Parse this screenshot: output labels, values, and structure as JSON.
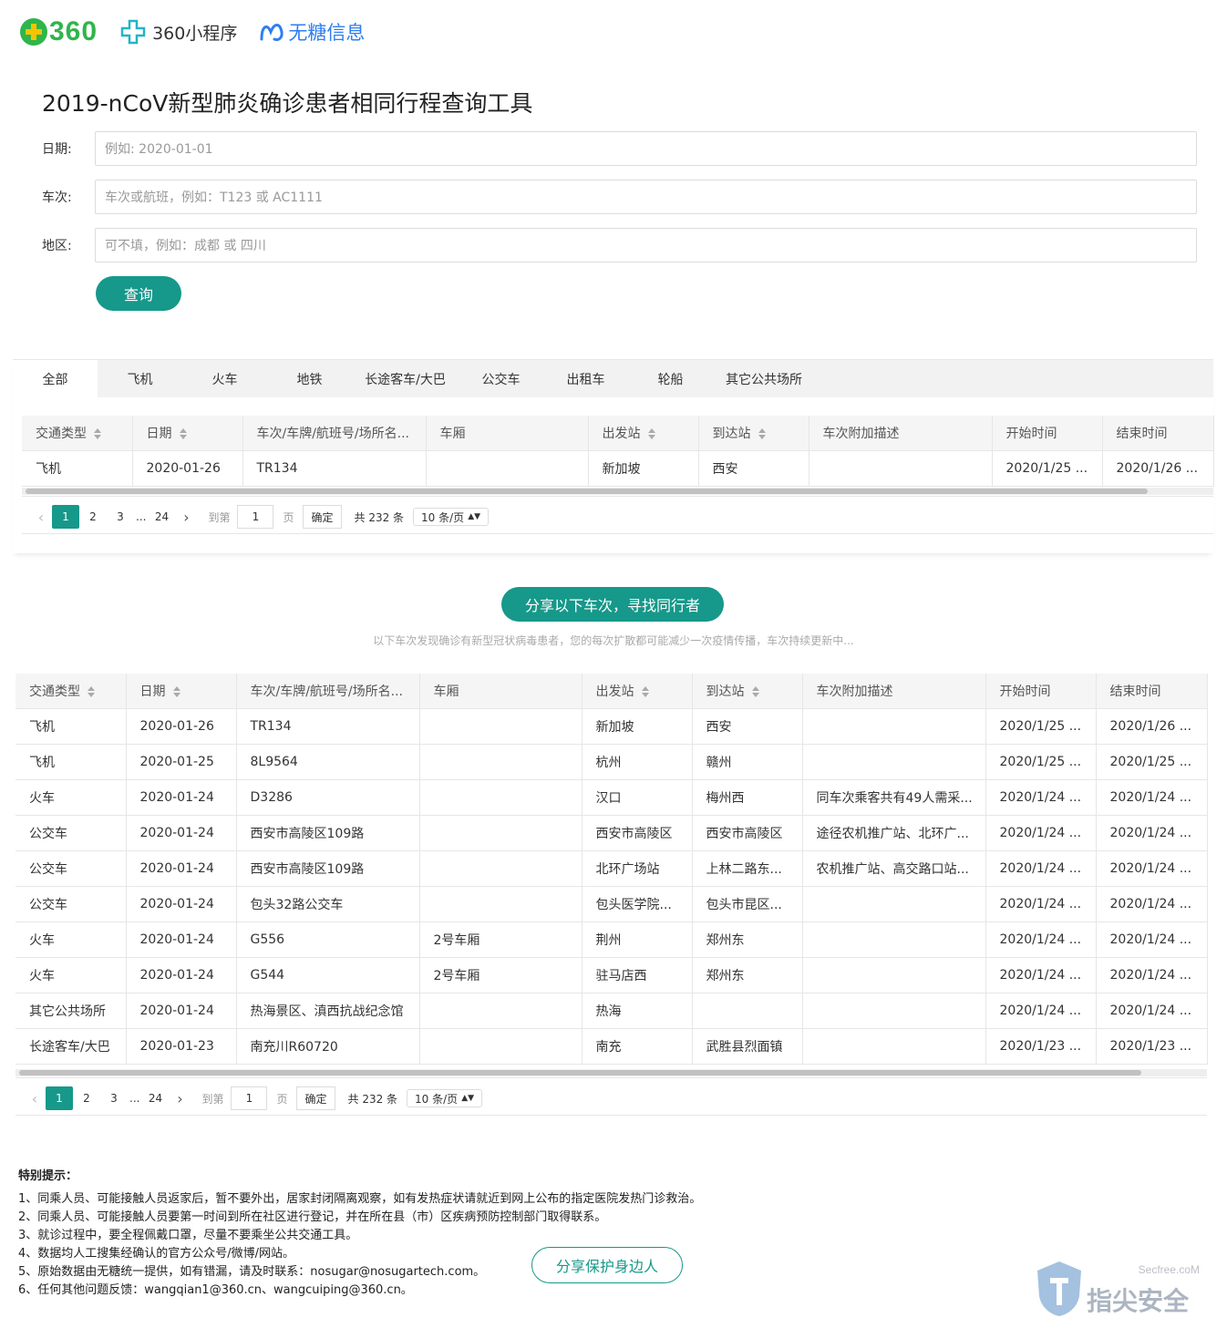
{
  "header": {
    "logo_360": "360",
    "logo_mini": "360小程序",
    "logo_wt": "无糖信息"
  },
  "page_title": "2019-nCoV新型肺炎确诊患者相同行程查询工具",
  "form": {
    "date_label": "日期:",
    "date_placeholder": "例如: 2020-01-01",
    "train_label": "车次:",
    "train_placeholder": "车次或航班，例如：T123 或 AC1111",
    "area_label": "地区:",
    "area_placeholder": "可不填，例如：成都 或 四川",
    "query_button": "查询"
  },
  "tabs": [
    "全部",
    "飞机",
    "火车",
    "地铁",
    "长途客车/大巴",
    "公交车",
    "出租车",
    "轮船",
    "其它公共场所"
  ],
  "active_tab": 0,
  "columns": [
    "交通类型",
    "日期",
    "车次/车牌/航班号/场所名...",
    "车厢",
    "出发站",
    "到达站",
    "车次附加描述",
    "开始时间",
    "结束时间"
  ],
  "search_results": [
    [
      "飞机",
      "2020-01-26",
      "TR134",
      "",
      "新加坡",
      "西安",
      "",
      "2020/1/25 ...",
      "2020/1/26 ..."
    ]
  ],
  "pagination": {
    "pages": [
      "1",
      "2",
      "3",
      "...",
      "24"
    ],
    "goto_label": "到第",
    "goto_value": "1",
    "page_unit": "页",
    "confirm": "确定",
    "total": "共 232 条",
    "page_size": "10 条/页"
  },
  "share": {
    "button": "分享以下车次，寻找同行者",
    "subtitle": "以下车次发现确诊有新型冠状病毒患者，您的每次扩散都可能减少一次疫情传播，车次持续更新中..."
  },
  "list_rows": [
    [
      "飞机",
      "2020-01-26",
      "TR134",
      "",
      "新加坡",
      "西安",
      "",
      "2020/1/25 ...",
      "2020/1/26 ..."
    ],
    [
      "飞机",
      "2020-01-25",
      "8L9564",
      "",
      "杭州",
      "赣州",
      "",
      "2020/1/25 ...",
      "2020/1/25 ..."
    ],
    [
      "火车",
      "2020-01-24",
      "D3286",
      "",
      "汉口",
      "梅州西",
      "同车次乘客共有49人需采...",
      "2020/1/24 ...",
      "2020/1/24 ..."
    ],
    [
      "公交车",
      "2020-01-24",
      "西安市高陵区109路",
      "",
      "西安市高陵区",
      "西安市高陵区",
      "途径农机推广站、北环广...",
      "2020/1/24 ...",
      "2020/1/24 ..."
    ],
    [
      "公交车",
      "2020-01-24",
      "西安市高陵区109路",
      "",
      "北环广场站",
      "上林二路东...",
      "农机推广站、高交路口站...",
      "2020/1/24 ...",
      "2020/1/24 ..."
    ],
    [
      "公交车",
      "2020-01-24",
      "包头32路公交车",
      "",
      "包头医学院...",
      "包头市昆区...",
      "",
      "2020/1/24 ...",
      "2020/1/24 ..."
    ],
    [
      "火车",
      "2020-01-24",
      "G556",
      "2号车厢",
      "荆州",
      "郑州东",
      "",
      "2020/1/24 ...",
      "2020/1/24 ..."
    ],
    [
      "火车",
      "2020-01-24",
      "G544",
      "2号车厢",
      "驻马店西",
      "郑州东",
      "",
      "2020/1/24 ...",
      "2020/1/24 ..."
    ],
    [
      "其它公共场所",
      "2020-01-24",
      "热海景区、滇西抗战纪念馆",
      "",
      "热海",
      "",
      "",
      "2020/1/24 ...",
      "2020/1/24 ..."
    ],
    [
      "长途客车/大巴",
      "2020-01-23",
      "南充川R60720",
      "",
      "南充",
      "武胜县烈面镇",
      "",
      "2020/1/23 ...",
      "2020/1/23 ..."
    ]
  ],
  "tips": {
    "title": "特别提示：",
    "items": [
      "1、同乘人员、可能接触人员返家后，暂不要外出，居家封闭隔离观察，如有发热症状请就近到网上公布的指定医院发热门诊救治。",
      "2、同乘人员、可能接触人员要第一时间到所在社区进行登记，并在所在县（市）区疾病预防控制部门取得联系。",
      "3、就诊过程中，要全程佩戴口罩，尽量不要乘坐公共交通工具。",
      "4、数据均人工搜集经确认的官方公众号/微博/网站。",
      "5、原始数据由无糖统一提供，如有错漏，请及时联系：nosugar@nosugartech.com。",
      "6、任何其他问题反馈：wangqian1@360.cn、wangcuiping@360.cn。"
    ],
    "protect_button": "分享保护身边人"
  },
  "watermark": {
    "site": "Secfree.coM",
    "name": "指尖安全"
  },
  "colors": {
    "accent": "#16988a",
    "brand_360_green": "#2fb54a",
    "brand_wt_blue": "#2d7ff0"
  }
}
